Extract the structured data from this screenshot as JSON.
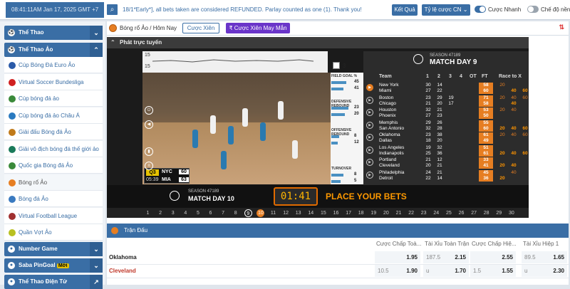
{
  "topbar": {
    "clock": "08:41:11AM Jan 17, 2025 GMT +7",
    "ticker": "18/1*Early*], all bets taken are considered REFUNDED. Parlay counted as one (1). Thank you!",
    "result_button": "Kết Quả",
    "odds_select": "Tỷ lệ cược CN",
    "fast_bet_label": "Cược Nhanh",
    "mode_label": "Chế độ nền",
    "fast_bet_on": true,
    "mode_on": false
  },
  "sidebar": {
    "sections": [
      {
        "label": "Thể Thao",
        "chevron": "⌄"
      },
      {
        "label": "Thể Thao Ảo",
        "chevron": "⌃"
      }
    ],
    "items": [
      {
        "label": "Cúp Bóng Đá Euro Ảo",
        "icon_color": "#2a5aa8"
      },
      {
        "label": "Virtual Soccer Bundesliga",
        "icon_color": "#d02020"
      },
      {
        "label": "Cúp bóng đá ảo",
        "icon_color": "#3a8a3a"
      },
      {
        "label": "Cúp bóng đá ảo Châu Á",
        "icon_color": "#2a7ac0"
      },
      {
        "label": "Giải đấu Bóng đá Ảo",
        "icon_color": "#c07a1a"
      },
      {
        "label": "Giải vô địch bóng đá thế giới ảo",
        "icon_color": "#1a7a5a"
      },
      {
        "label": "Quốc gia Bóng đá Ảo",
        "icon_color": "#3a8a3a"
      },
      {
        "label": "Bóng rổ Ảo",
        "icon_color": "#e67e22",
        "selected": true
      },
      {
        "label": "Bóng đá Ảo",
        "icon_color": "#3a7ac0"
      },
      {
        "label": "Virtual Football League",
        "icon_color": "#a03030"
      },
      {
        "label": "Quần Vợt Ảo",
        "icon_color": "#b8c020"
      }
    ],
    "bottom_sections": [
      {
        "label": "Number Game",
        "chevron": "⌄"
      },
      {
        "label": "Saba PinGoal",
        "badge": "Mới",
        "chevron": "⌄"
      },
      {
        "label": "Thể Thao Điện Tử",
        "chevron": "↗"
      }
    ]
  },
  "page_header": {
    "title": "Bóng rổ Ảo / Hôm Nay",
    "tab_parlay": "Cược Xiên",
    "tab_lucky": "Cược Xiên May Mắn",
    "sort_icon": "⇅"
  },
  "stream": {
    "header": "Phát trực tuyến",
    "ticker_chart": {
      "top": "15",
      "bottom": "15",
      "box_label": "3"
    },
    "score": {
      "quarter": "Q3",
      "time": "05:39",
      "team_a": "NYC",
      "score_a": "60",
      "team_b": "MIA",
      "score_b": "63"
    },
    "stats": [
      {
        "label": "FIELD GOAL %",
        "v1": "45",
        "v2": "41",
        "fill": 0.75
      },
      {
        "label": "DEFENSIVE REBOUND",
        "v1": "23",
        "v2": "20",
        "fill": 0.85
      },
      {
        "label": "OFFENSIVE REBOUND",
        "v1": "8",
        "v2": "12",
        "fill": 0.4
      },
      {
        "label": "TURNOVER",
        "v1": "8",
        "v2": "5",
        "fill": 0.6
      }
    ],
    "bets_bar": {
      "season": "SEASON 47189",
      "match_day": "MATCH DAY 10",
      "timer": "01:41",
      "place": "PLACE YOUR BETS"
    },
    "timeline": [
      "1",
      "2",
      "3",
      "4",
      "5",
      "6",
      "7",
      "8",
      "9",
      "10",
      "11",
      "12",
      "13",
      "14",
      "15",
      "16",
      "17",
      "18",
      "19",
      "20",
      "21",
      "22",
      "23",
      "24",
      "25",
      "26",
      "27",
      "28",
      "29",
      "30"
    ],
    "timeline_current": "9",
    "timeline_live": "10"
  },
  "scoreboard": {
    "season": "SEASON 47189",
    "match_day": "MATCH DAY 9",
    "headers": {
      "team": "Team",
      "q1": "1",
      "q2": "2",
      "q3": "3",
      "q4": "4",
      "ot": "OT",
      "ft": "FT",
      "race": "Race to X"
    },
    "matches": [
      {
        "home": "New York",
        "away": "Miami",
        "q1": [
          "30",
          "27"
        ],
        "q2": [
          "14",
          "22"
        ],
        "q3": [
          "",
          ""
        ],
        "q4": [
          "",
          ""
        ],
        "ot": [
          "",
          ""
        ],
        "ft": [
          "58",
          "60"
        ],
        "race": [
          [
            "20",
            "",
            ""
          ],
          [
            "",
            "40",
            "60"
          ]
        ],
        "active": true
      },
      {
        "home": "Boston",
        "away": "Chicago",
        "q1": [
          "23",
          "21"
        ],
        "q2": [
          "29",
          "20"
        ],
        "q3": [
          "19",
          "17"
        ],
        "q4": [
          "",
          ""
        ],
        "ot": [
          "",
          ""
        ],
        "ft": [
          "71",
          "58"
        ],
        "race": [
          [
            "20",
            "40",
            "60"
          ],
          [
            "",
            "40",
            ""
          ]
        ]
      },
      {
        "home": "Houston",
        "away": "Phoenix",
        "q1": [
          "32",
          "27"
        ],
        "q2": [
          "21",
          "23"
        ],
        "q3": [
          "",
          ""
        ],
        "q4": [
          "",
          ""
        ],
        "ot": [
          "",
          ""
        ],
        "ft": [
          "53",
          "50"
        ],
        "race": [
          [
            "20",
            "40",
            ""
          ],
          [
            "",
            "",
            ""
          ]
        ]
      },
      {
        "home": "Memphis",
        "away": "San Antonio",
        "q1": [
          "29",
          "32"
        ],
        "q2": [
          "26",
          "28"
        ],
        "q3": [
          "",
          ""
        ],
        "q4": [
          "",
          ""
        ],
        "ot": [
          "",
          ""
        ],
        "ft": [
          "55",
          "60"
        ],
        "race": [
          [
            "",
            "",
            ""
          ],
          [
            "20",
            "40",
            "60"
          ]
        ]
      },
      {
        "home": "Oklahoma",
        "away": "Dallas",
        "q1": [
          "23",
          "18"
        ],
        "q2": [
          "38",
          "20"
        ],
        "q3": [
          "",
          ""
        ],
        "q4": [
          "",
          ""
        ],
        "ot": [
          "",
          ""
        ],
        "ft": [
          "61",
          "49"
        ],
        "race": [
          [
            "20",
            "40",
            "60"
          ],
          [
            "",
            "",
            ""
          ]
        ]
      },
      {
        "home": "Los Angeles",
        "away": "Indianapolis",
        "q1": [
          "19",
          "25"
        ],
        "q2": [
          "32",
          "36"
        ],
        "q3": [
          "",
          ""
        ],
        "q4": [
          "",
          ""
        ],
        "ot": [
          "",
          ""
        ],
        "ft": [
          "51",
          "61"
        ],
        "race": [
          [
            "",
            "",
            ""
          ],
          [
            "20",
            "40",
            "60"
          ]
        ]
      },
      {
        "home": "Portland",
        "away": "Cleveland",
        "q1": [
          "21",
          "20"
        ],
        "q2": [
          "12",
          "21"
        ],
        "q3": [
          "",
          ""
        ],
        "q4": [
          "",
          ""
        ],
        "ot": [
          "",
          ""
        ],
        "ft": [
          "33",
          "41"
        ],
        "race": [
          [
            "",
            "",
            ""
          ],
          [
            "20",
            "40",
            ""
          ]
        ]
      },
      {
        "home": "Philadelphia",
        "away": "Detroit",
        "q1": [
          "24",
          "22"
        ],
        "q2": [
          "21",
          "14"
        ],
        "q3": [
          "",
          ""
        ],
        "q4": [
          "",
          ""
        ],
        "ot": [
          "",
          ""
        ],
        "ft": [
          "45",
          "36"
        ],
        "race": [
          [
            "",
            "40",
            ""
          ],
          [
            "20",
            "",
            ""
          ]
        ]
      }
    ]
  },
  "matches_section": {
    "header": "Trận Đấu",
    "columns": [
      "Cược Chấp Toà...",
      "Tài Xỉu Toàn Trận",
      "Cược Chấp Hiệ...",
      "Tài Xỉu Hiệp 1"
    ],
    "rows": [
      {
        "team": "Oklahoma",
        "team_color": "#222",
        "cells": [
          [
            "",
            "1.95"
          ],
          [
            "187.5",
            "2.15"
          ],
          [
            "",
            "2.55"
          ],
          [
            "89.5",
            "1.65"
          ]
        ]
      },
      {
        "team": "Cleveland",
        "team_color": "#c0392b",
        "cells": [
          [
            "10.5",
            "1.90"
          ],
          [
            "u",
            "1.70"
          ],
          [
            "1.5",
            "1.55"
          ],
          [
            "u",
            "2.30"
          ]
        ]
      }
    ]
  }
}
